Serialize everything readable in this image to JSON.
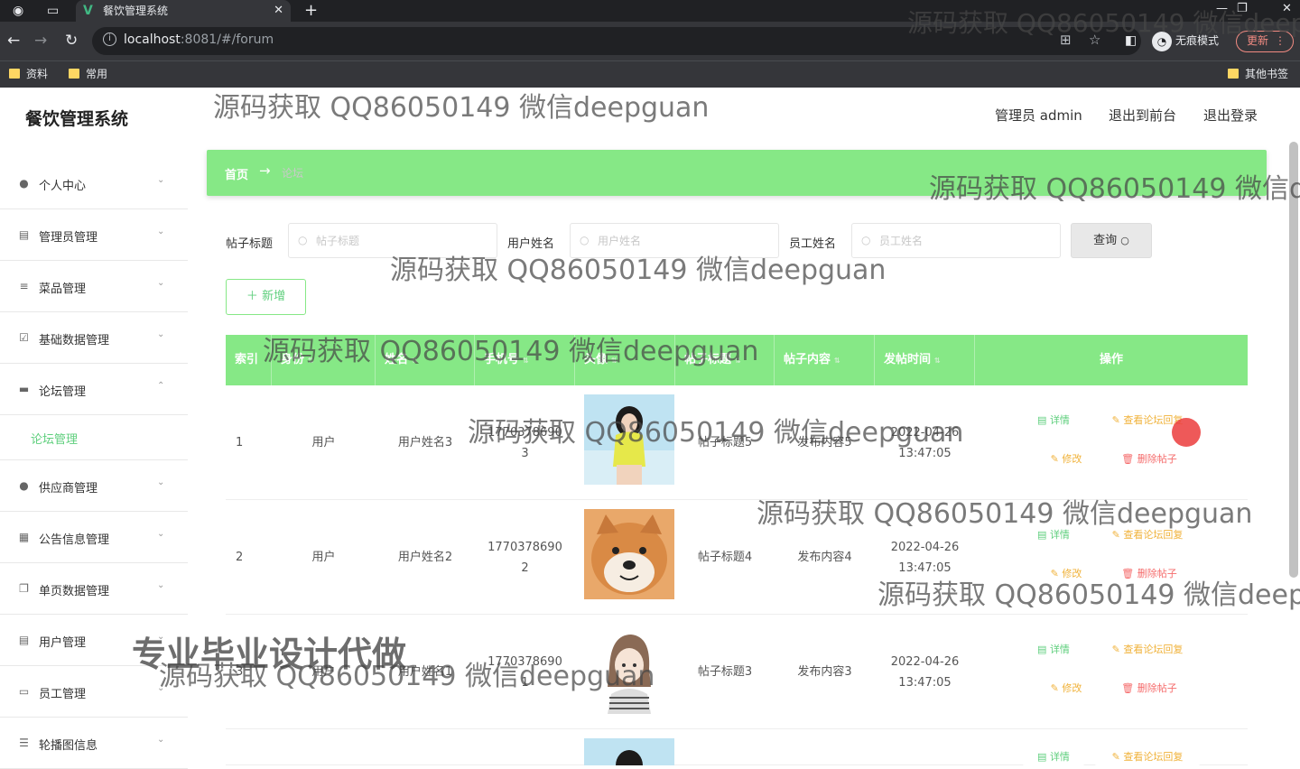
{
  "browser": {
    "tab_title": "餐饮管理系统",
    "url_host": "localhost",
    "url_rest": ":8081/#/forum",
    "incognito_label": "无痕模式",
    "update_label": "更新",
    "bookmarks": [
      "资料",
      "常用"
    ],
    "other_bookmarks": "其他书签"
  },
  "app": {
    "title": "餐饮管理系统",
    "user_label": "管理员 admin",
    "to_front": "退出到前台",
    "logout": "退出登录"
  },
  "sidebar": {
    "items": [
      {
        "label": "个人中心",
        "icon": "user-icon"
      },
      {
        "label": "管理员管理",
        "icon": "clipboard-icon"
      },
      {
        "label": "菜品管理",
        "icon": "sliders-icon"
      },
      {
        "label": "基础数据管理",
        "icon": "check-square-icon"
      },
      {
        "label": "论坛管理",
        "icon": "briefcase-icon",
        "sub": "论坛管理"
      },
      {
        "label": "供应商管理",
        "icon": "user-icon"
      },
      {
        "label": "公告信息管理",
        "icon": "chart-icon"
      },
      {
        "label": "单页数据管理",
        "icon": "copy-icon"
      },
      {
        "label": "用户管理",
        "icon": "clipboard-icon"
      },
      {
        "label": "员工管理",
        "icon": "chat-icon"
      },
      {
        "label": "轮播图信息",
        "icon": "list-icon"
      }
    ]
  },
  "breadcrumb": {
    "home": "首页",
    "arrow": "→",
    "current": "论坛"
  },
  "search": {
    "title_label": "帖子标题",
    "title_placeholder": "帖子标题",
    "user_label": "用户姓名",
    "user_placeholder": "用户姓名",
    "staff_label": "员工姓名",
    "staff_placeholder": "员工姓名",
    "query_label": "查询"
  },
  "add_label": "新增",
  "table": {
    "headers": [
      "索引",
      "身份",
      "姓名",
      "手机号",
      "头像",
      "帖子标题",
      "帖子内容",
      "发帖时间",
      "操作"
    ],
    "actions": {
      "detail": "详情",
      "reply": "查看论坛回复",
      "edit": "修改",
      "delete": "删除帖子"
    },
    "rows": [
      {
        "index": "1",
        "role": "用户",
        "name": "用户姓名3",
        "phone_a": "1770378690",
        "phone_b": "3",
        "title": "帖子标题5",
        "content": "发布内容5",
        "date": "2022-04-26",
        "time": "13:47:05"
      },
      {
        "index": "2",
        "role": "用户",
        "name": "用户姓名2",
        "phone_a": "1770378690",
        "phone_b": "2",
        "title": "帖子标题4",
        "content": "发布内容4",
        "date": "2022-04-26",
        "time": "13:47:05"
      },
      {
        "index": "3",
        "role": "用户",
        "name": "用户姓名1",
        "phone_a": "1770378690",
        "phone_b": "1",
        "title": "帖子标题3",
        "content": "发布内容3",
        "date": "2022-04-26",
        "time": "13:47:05"
      },
      {
        "index": "",
        "role": "",
        "name": "",
        "phone_a": "",
        "phone_b": "",
        "title": "",
        "content": "",
        "date": "",
        "time": ""
      }
    ]
  },
  "watermarks": {
    "text": "源码获取 QQ86050149 微信deepguan",
    "big": "专业毕业设计代做"
  },
  "colors": {
    "accent": "#86e886",
    "accent_text": "#5fcf7d",
    "warning": "#f0b23a",
    "danger": "#f56c6c"
  }
}
